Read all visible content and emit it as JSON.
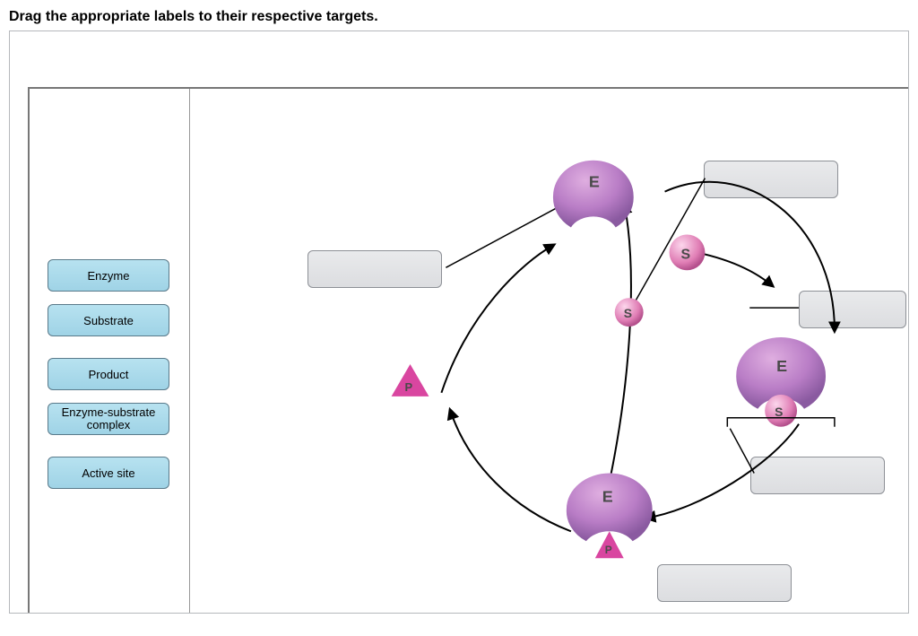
{
  "instruction": "Drag the appropriate labels to their respective targets.",
  "labels": {
    "enzyme": "Enzyme",
    "substrate": "Substrate",
    "product": "Product",
    "es_complex": "Enzyme-substrate complex",
    "active_site": "Active site"
  },
  "glyphs": {
    "E": "E",
    "S": "S",
    "P": "P"
  }
}
